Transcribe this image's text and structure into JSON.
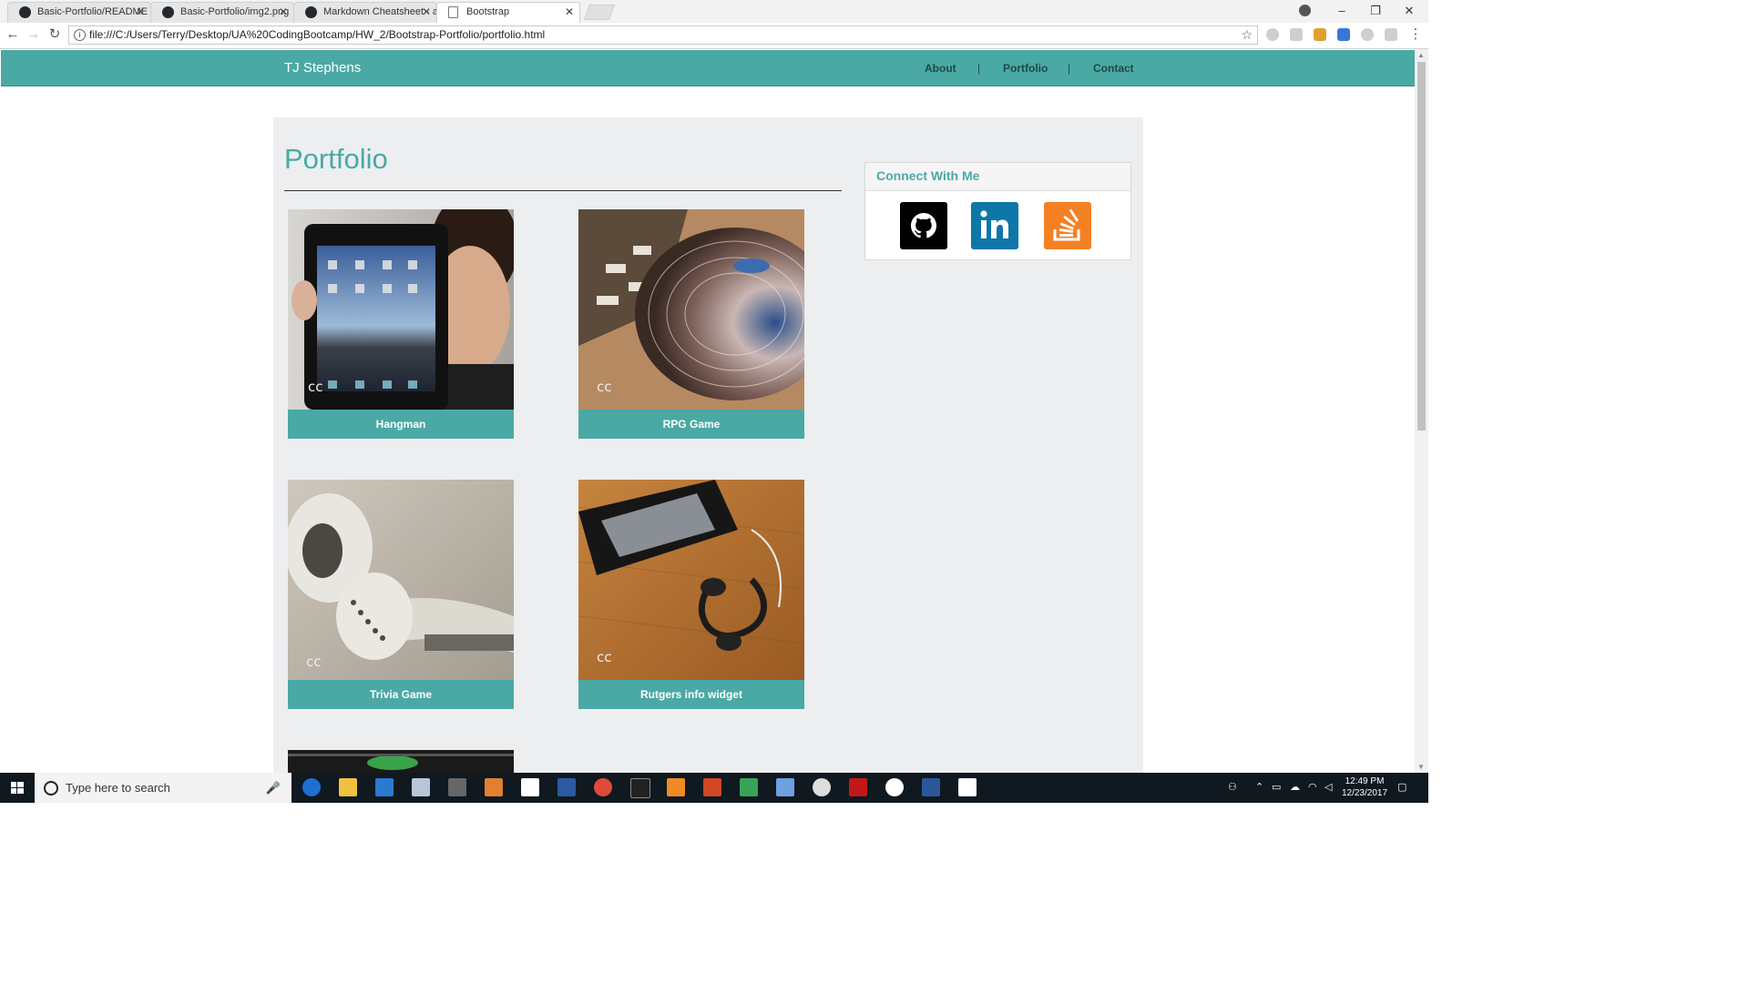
{
  "browser": {
    "tabs": [
      {
        "title": "Basic-Portfolio/README",
        "favicon": "github-icon"
      },
      {
        "title": "Basic-Portfolio/img2.png",
        "favicon": "github-icon"
      },
      {
        "title": "Markdown Cheatsheet · a",
        "favicon": "github-icon"
      },
      {
        "title": "Bootstrap",
        "favicon": "page-icon",
        "active": true
      }
    ],
    "close_glyph": "✕",
    "address": "file:///C:/Users/Terry/Desktop/UA%20CodingBootcamp/HW_2/Bootstrap-Portfolio/portfolio.html"
  },
  "site": {
    "brand": "TJ Stephens",
    "nav": [
      {
        "label": "About"
      },
      {
        "label": "Portfolio"
      },
      {
        "label": "Contact"
      }
    ],
    "nav_separator": "|",
    "accent_color": "#4aa9a4",
    "page_title": "Portfolio",
    "projects": [
      {
        "caption": "Hangman",
        "image": "tablet-photo"
      },
      {
        "caption": "RPG Game",
        "image": "turntable-photo"
      },
      {
        "caption": "Trivia Game",
        "image": "earbuds-photo"
      },
      {
        "caption": "Rutgers info widget",
        "image": "phone-earbuds-photo"
      },
      {
        "caption": "",
        "image": "dark-photo"
      }
    ],
    "connect": {
      "heading": "Connect With Me",
      "links": [
        {
          "name": "GitHub",
          "icon": "github-icon",
          "color": "#000000"
        },
        {
          "name": "LinkedIn",
          "icon": "linkedin-icon",
          "color": "#0e76a8"
        },
        {
          "name": "Stack Overflow",
          "icon": "stackoverflow-icon",
          "color": "#f48024"
        }
      ]
    }
  },
  "taskbar": {
    "search_placeholder": "Type here to search",
    "time": "12:49 PM",
    "date": "12/23/2017"
  }
}
